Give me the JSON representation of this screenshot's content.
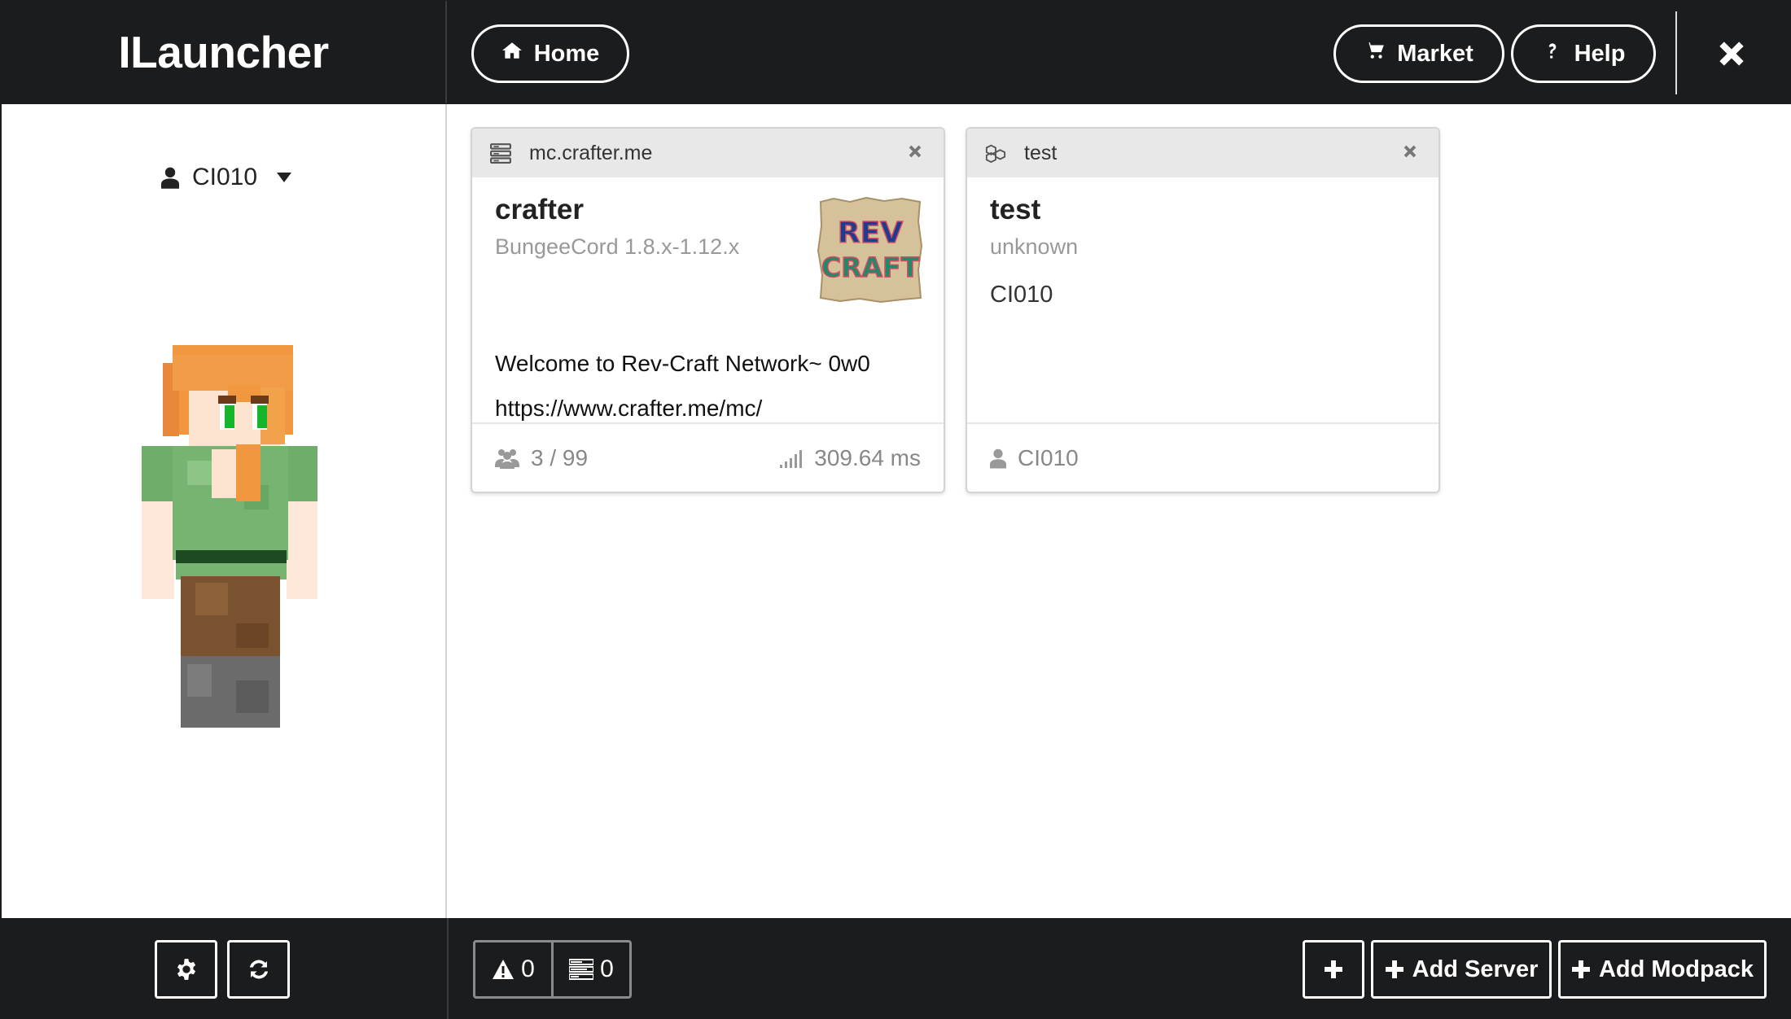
{
  "app": {
    "title": "ILauncher"
  },
  "header": {
    "home_label": "Home",
    "market_label": "Market",
    "help_label": "Help"
  },
  "sidebar": {
    "username": "CI010"
  },
  "cards": [
    {
      "host": "mc.crafter.me",
      "name": "crafter",
      "version": "BungeeCord 1.8.x-1.12.x",
      "logo_text": [
        "REV",
        "CRAFT"
      ],
      "motd": "Welcome to Rev-Craft Network~ 0w0",
      "url": "https://www.crafter.me/mc/",
      "players": "3 / 99",
      "ping": "309.64 ms"
    },
    {
      "host": "test",
      "name": "test",
      "version": "unknown",
      "owner": "CI010",
      "footer_user": "CI010"
    }
  ],
  "footer": {
    "warnings_count": "0",
    "tasks_count": "0",
    "add_server_label": "Add Server",
    "add_modpack_label": "Add Modpack"
  },
  "colors": {
    "bar_bg": "#1b1c1d",
    "card_header_bg": "#e8e8e8",
    "muted_text": "#999999"
  }
}
